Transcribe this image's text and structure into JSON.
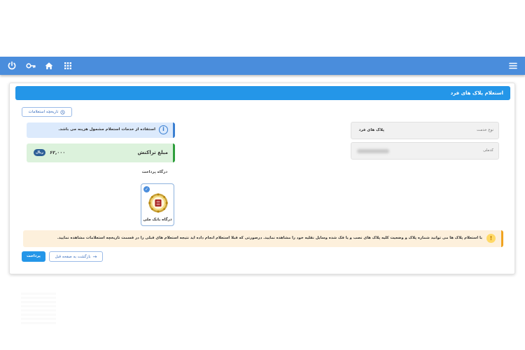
{
  "topbar": {
    "icons": [
      "power-icon",
      "key-icon",
      "home-icon",
      "grid-icon",
      "menu-icon"
    ],
    "color": "#4a8ddc"
  },
  "card": {
    "title": "استعلام پلاک های فرد",
    "header_color": "#2496e8"
  },
  "history_button": {
    "label": "تاریخچه استعلامات",
    "icon": "history-icon"
  },
  "service": {
    "label": "نوع خدمت",
    "value": "پلاک های فرد"
  },
  "national_code": {
    "label": "کدملی"
  },
  "info_alert": {
    "text": "استفاده از خدمات استعلام مشمول هزینه می باشد."
  },
  "amount": {
    "label": "مبلغ تراکنش",
    "value": "۶۲,۰۰۰",
    "currency": "ریال"
  },
  "gateway": {
    "title": "درگاه پرداخت",
    "option_name": "درگاه بانک ملی",
    "selected": true
  },
  "warning_alert": {
    "text": "با استعلام پلاک ها می توانید شماره پلاک و وضعیت کلیه پلاک های نصب و یا فک شده وسایل نقلیه خود را مشاهده نمایید. درصورتی که قبلا استعلام انجام داده اید نتیجه استعلام های قبلی را در قسمت تاریخچه استعلامات مشاهده نمایید."
  },
  "actions": {
    "pay_label": "پرداخت",
    "back_label": "بازگشت به صفحه قبل"
  }
}
